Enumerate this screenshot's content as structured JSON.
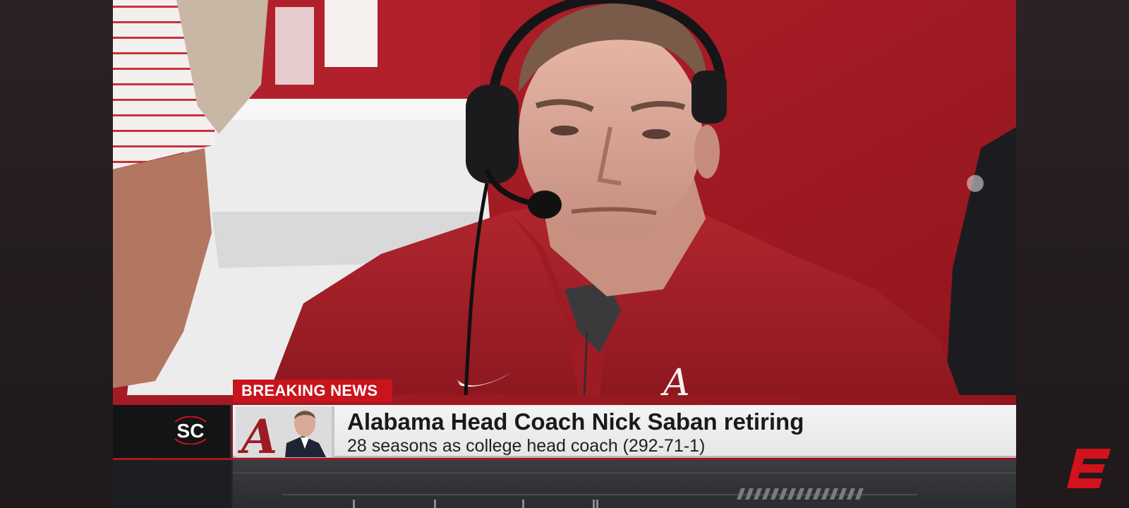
{
  "broadcast": {
    "breaking_label": "BREAKING NEWS",
    "headline": "Alabama Head Coach Nick Saban retiring",
    "subline": "28 seasons as college head coach (292-71-1)",
    "show_bug": "SC",
    "network": "ESPN"
  },
  "colors": {
    "breaking_red": "#c8141c",
    "crimson": "#9e1b24",
    "espn_red": "#d2121c",
    "bar_light": "#efefef",
    "bar_dark": "#131416"
  },
  "icons": {
    "show_logo": "sportscenter-logo-icon",
    "network_logo": "espn-logo-icon",
    "team_logo": "alabama-a-icon"
  }
}
